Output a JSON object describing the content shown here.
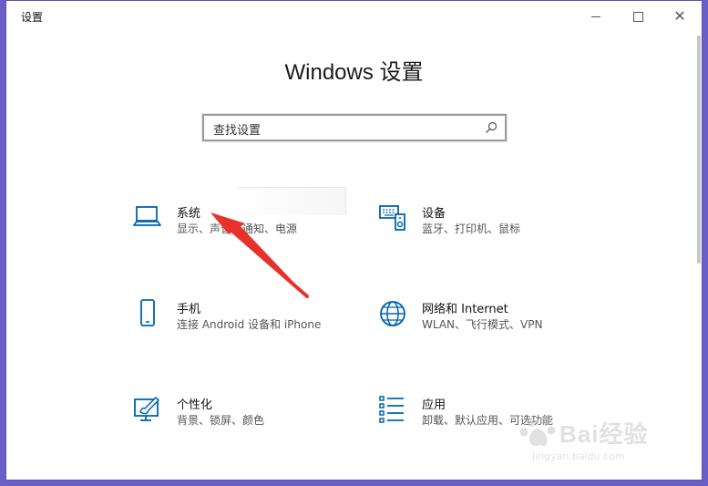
{
  "window": {
    "title": "设置"
  },
  "header": {
    "title": "Windows 设置"
  },
  "search": {
    "placeholder": "查找设置"
  },
  "tiles": [
    {
      "title": "系统",
      "subtitle": "显示、声音、通知、电源",
      "icon": "laptop-icon"
    },
    {
      "title": "设备",
      "subtitle": "蓝牙、打印机、鼠标",
      "icon": "devices-icon"
    },
    {
      "title": "手机",
      "subtitle": "连接 Android 设备和 iPhone",
      "icon": "phone-icon"
    },
    {
      "title": "网络和 Internet",
      "subtitle": "WLAN、飞行模式、VPN",
      "icon": "globe-icon"
    },
    {
      "title": "个性化",
      "subtitle": "背景、锁屏、颜色",
      "icon": "paint-icon"
    },
    {
      "title": "应用",
      "subtitle": "卸载、默认应用、可选功能",
      "icon": "apps-list-icon"
    }
  ],
  "watermark": {
    "brand": "Bai经验",
    "url": "jingyan.baidu.com"
  },
  "colors": {
    "accent": "#0063b1",
    "arrow": "#e8312b",
    "background": "#6a5fc8"
  }
}
